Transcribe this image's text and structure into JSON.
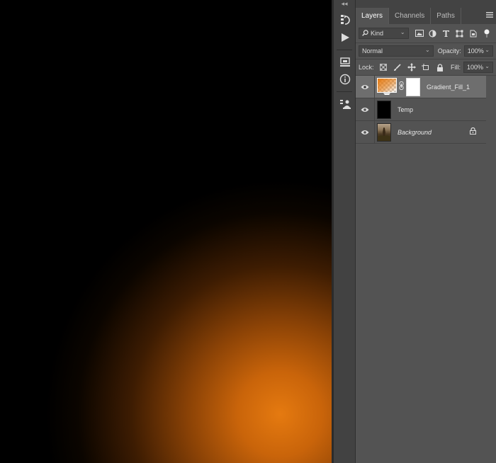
{
  "panel": {
    "tabs": [
      {
        "label": "Layers",
        "active": true
      },
      {
        "label": "Channels",
        "active": false
      },
      {
        "label": "Paths",
        "active": false
      }
    ],
    "filter": {
      "kind_label": "Kind"
    },
    "blend_mode": "Normal",
    "opacity_label": "Opacity:",
    "opacity_value": "100%",
    "lock_label": "Lock:",
    "fill_label": "Fill:",
    "fill_value": "100%",
    "layers": [
      {
        "name": "Gradient_Fill_1",
        "visible": true,
        "selected": true,
        "has_mask": true,
        "italic": false,
        "locked": false
      },
      {
        "name": "Temp",
        "visible": true,
        "selected": false,
        "has_mask": false,
        "italic": false,
        "locked": false
      },
      {
        "name": "Background",
        "visible": true,
        "selected": false,
        "has_mask": false,
        "italic": true,
        "locked": true
      }
    ]
  },
  "toolstrip": {
    "collapse_label": "◂◂",
    "tools": [
      "history-brush-icon",
      "play-icon",
      "properties-icon",
      "info-icon",
      "layer-comps-icon"
    ]
  },
  "colors": {
    "canvas_glow": "#e57a10",
    "panel_bg": "#535353",
    "selected_row": "#6e6e6e"
  }
}
